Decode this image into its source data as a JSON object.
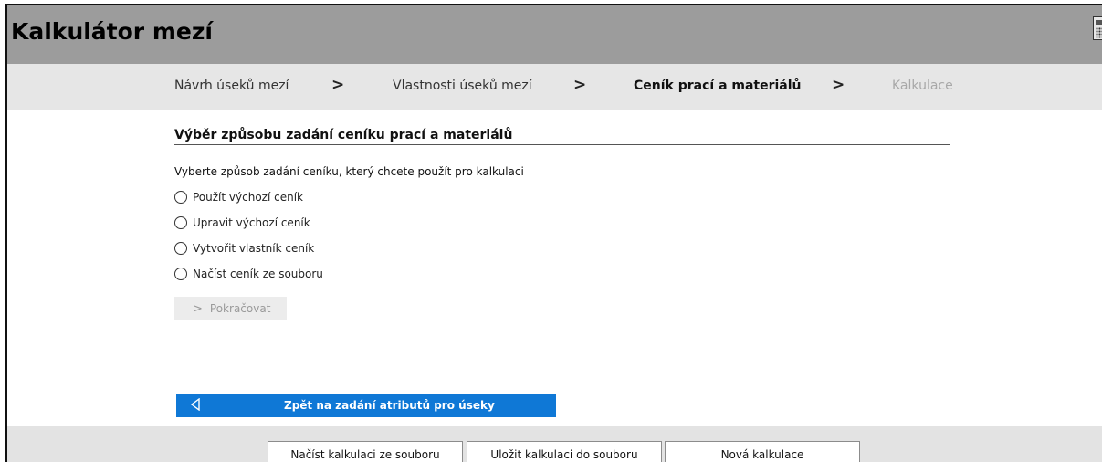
{
  "app": {
    "title": "Kalkulátor mezí",
    "calculator_icon": "calculator-icon"
  },
  "steps": [
    {
      "label": "Návrh úseků mezí",
      "state": "normal"
    },
    {
      "label": "Vlastnosti úseků mezí",
      "state": "normal"
    },
    {
      "label": "Ceník prací a materiálů",
      "state": "active"
    },
    {
      "label": "Kalkulace",
      "state": "disabled"
    }
  ],
  "step_separator": "›",
  "section": {
    "title": "Výběr způsobu zadání ceníku prací a materiálů",
    "instruction": "Vyberte způsob zadání ceníku, který chcete použít pro kalkulaci",
    "options": [
      {
        "label": "Použít výchozí ceník",
        "selected": false
      },
      {
        "label": "Upravit výchozí ceník",
        "selected": false
      },
      {
        "label": "Vytvořit vlastník ceník",
        "selected": false
      },
      {
        "label": "Načíst ceník ze souboru",
        "selected": false
      }
    ],
    "continue_label": "Pokračovat",
    "continue_enabled": false
  },
  "back_button": {
    "label": "Zpět na zadání atributů pro úseky",
    "icon": "triangle-left-icon",
    "color": "#0f78d6"
  },
  "footer": {
    "load_label": "Načíst kalkulaci ze souboru",
    "save_label": "Uložit kalkulaci do souboru",
    "new_label": "Nová kalkulace"
  },
  "colors": {
    "titlebar": "#9c9c9c",
    "stepbar": "#e6e6e6",
    "footer": "#e3e3e3",
    "accent": "#0f78d6"
  }
}
